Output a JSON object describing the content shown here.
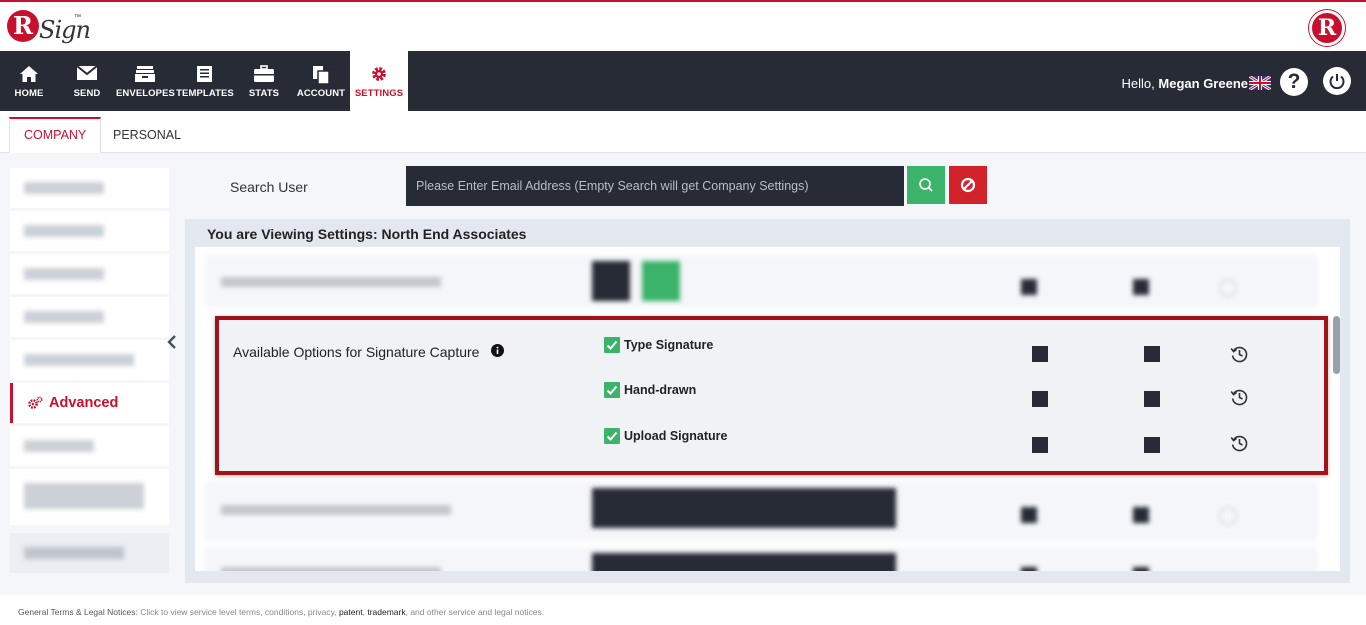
{
  "brand": {
    "logo_text": "Sign",
    "logo_tm": "™",
    "logo_letter": "R",
    "brand_letter": "R"
  },
  "nav": {
    "items": [
      {
        "label": "HOME"
      },
      {
        "label": "SEND"
      },
      {
        "label": "ENVELOPES"
      },
      {
        "label": "TEMPLATES"
      },
      {
        "label": "STATS"
      },
      {
        "label": "ACCOUNT"
      },
      {
        "label": "SETTINGS"
      }
    ],
    "hello_prefix": "Hello,",
    "user_name": "Megan Greene",
    "help_symbol": "?"
  },
  "tabs": {
    "company": "COMPANY",
    "personal": "PERSONAL"
  },
  "sidebar": {
    "active_label": "Advanced"
  },
  "search": {
    "label": "Search User",
    "placeholder": "Please Enter Email Address (Empty Search will get Company Settings)"
  },
  "panel": {
    "viewing_text": "You are Viewing Settings: North End Associates",
    "setting_label": "Available Options for Signature Capture",
    "options": [
      {
        "label": "Type Signature",
        "checked": true
      },
      {
        "label": "Hand-drawn",
        "checked": true
      },
      {
        "label": "Upload Signature",
        "checked": true
      }
    ]
  },
  "footer": {
    "title": "General Terms & Legal Notices:",
    "text1": "Click to view service level terms, conditions, privacy,",
    "patent": "patent",
    "comma": ",",
    "trademark": "trademark",
    "text2": ", and other service and legal notices."
  },
  "colors": {
    "accent": "#c8102e",
    "nav_bg": "#262b36",
    "success": "#3bb36a",
    "danger": "#d2232a"
  }
}
